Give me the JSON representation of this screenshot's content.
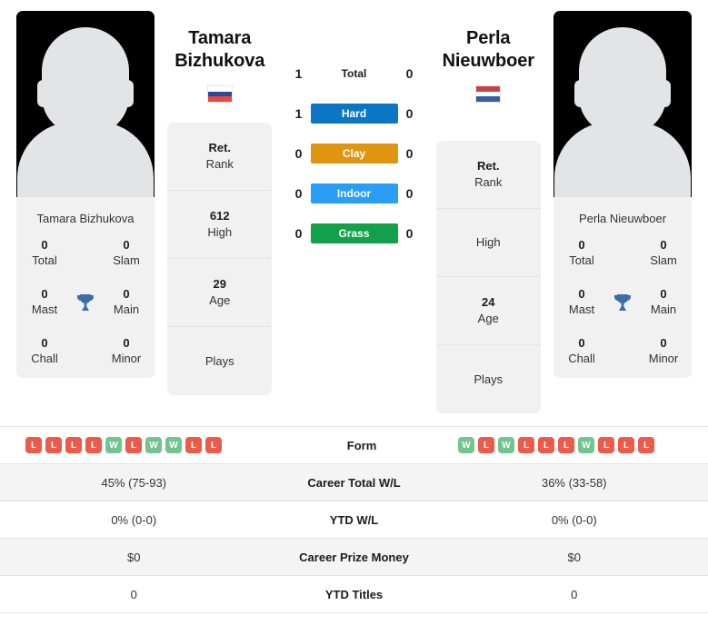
{
  "players": {
    "left": {
      "first_name": "Tamara",
      "last_name": "Bizhukova",
      "full_name": "Tamara Bizhukova",
      "flag": {
        "name": "russia-flag",
        "stripes": [
          "#ffffff",
          "#2a4a9c",
          "#e8473f"
        ]
      },
      "titles": [
        {
          "value": "0",
          "label": "Total"
        },
        {
          "value": "0",
          "label": "Slam"
        },
        {
          "value": "0",
          "label": "Mast"
        },
        {
          "value": "0",
          "label": "Main"
        },
        {
          "value": "0",
          "label": "Chall"
        },
        {
          "value": "0",
          "label": "Minor"
        }
      ],
      "ranking": [
        {
          "value": "Ret.",
          "label": "Rank"
        },
        {
          "value": "612",
          "label": "High"
        },
        {
          "value": "29",
          "label": "Age"
        },
        {
          "value": "",
          "label": "Plays"
        }
      ]
    },
    "right": {
      "first_name": "Perla",
      "last_name": "Nieuwboer",
      "full_name": "Perla Nieuwboer",
      "flag": {
        "name": "netherlands-flag",
        "stripes": [
          "#c8404a",
          "#ffffff",
          "#3a5ba0"
        ]
      },
      "titles": [
        {
          "value": "0",
          "label": "Total"
        },
        {
          "value": "0",
          "label": "Slam"
        },
        {
          "value": "0",
          "label": "Mast"
        },
        {
          "value": "0",
          "label": "Main"
        },
        {
          "value": "0",
          "label": "Chall"
        },
        {
          "value": "0",
          "label": "Minor"
        }
      ],
      "ranking": [
        {
          "value": "Ret.",
          "label": "Rank"
        },
        {
          "value": "",
          "label": "High"
        },
        {
          "value": "24",
          "label": "Age"
        },
        {
          "value": "",
          "label": "Plays"
        }
      ]
    }
  },
  "head_to_head": [
    {
      "label": "Total",
      "left": "1",
      "right": "0",
      "color": "",
      "is_total": true
    },
    {
      "label": "Hard",
      "left": "1",
      "right": "0",
      "color": "#0b76c4",
      "is_total": false
    },
    {
      "label": "Clay",
      "left": "0",
      "right": "0",
      "color": "#e09510",
      "is_total": false
    },
    {
      "label": "Indoor",
      "left": "0",
      "right": "0",
      "color": "#2a9df4",
      "is_total": false
    },
    {
      "label": "Grass",
      "left": "0",
      "right": "0",
      "color": "#13a04a",
      "is_total": false
    }
  ],
  "comparison": {
    "form_label": "Form",
    "left_form": [
      "L",
      "L",
      "L",
      "L",
      "W",
      "L",
      "W",
      "W",
      "L",
      "L"
    ],
    "right_form": [
      "W",
      "L",
      "W",
      "L",
      "L",
      "L",
      "W",
      "L",
      "L",
      "L"
    ],
    "rows": [
      {
        "label": "Career Total W/L",
        "left": "45% (75-93)",
        "right": "36% (33-58)"
      },
      {
        "label": "YTD W/L",
        "left": "0% (0-0)",
        "right": "0% (0-0)"
      },
      {
        "label": "Career Prize Money",
        "left": "$0",
        "right": "$0"
      },
      {
        "label": "YTD Titles",
        "left": "0",
        "right": "0"
      }
    ]
  },
  "icons": {
    "trophy": "trophy-icon",
    "silhouette": "player-silhouette-icon"
  },
  "colors": {
    "form_win": "#74c490",
    "form_loss": "#ec5b4a",
    "card_bg": "#f1f1f1",
    "row_shade": "#f4f4f4",
    "trophy": "#3b6ea5"
  }
}
